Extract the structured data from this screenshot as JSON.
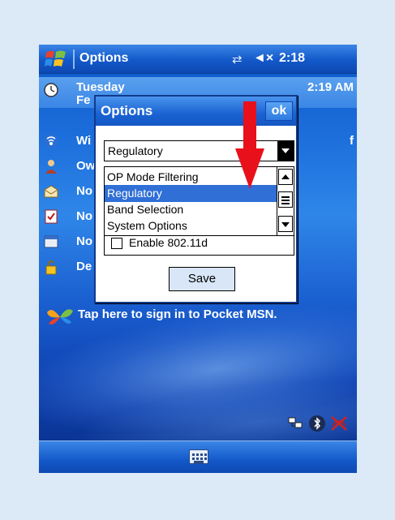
{
  "titlebar": {
    "title": "Options",
    "time": "2:18",
    "volume_glyph": "◄×",
    "connection_glyph": "⇄"
  },
  "today": {
    "day": "Tuesday",
    "date_fragment": "Fe",
    "time_right": "2:19 AM",
    "rows": [
      {
        "icon": "wireless-icon",
        "label": "Wi",
        "right": "f"
      },
      {
        "icon": "owner-icon",
        "label": "Ow",
        "right": ""
      },
      {
        "icon": "inbox-icon",
        "label": "No",
        "right": ""
      },
      {
        "icon": "tasks-icon",
        "label": "No",
        "right": ""
      },
      {
        "icon": "calendar-icon",
        "label": "No",
        "right": ""
      },
      {
        "icon": "lock-icon",
        "label": "De",
        "right": ""
      }
    ],
    "msn_text": "Tap here to sign in to Pocket MSN."
  },
  "dialog": {
    "title": "Options",
    "ok_label": "ok",
    "combo_value": "Regulatory",
    "dropdown_items": [
      "OP Mode Filtering",
      "Regulatory",
      "Band Selection",
      "System Options"
    ],
    "selected_index": 1,
    "checkbox_label": "Enable 802.11d",
    "save_label": "Save"
  },
  "tray": {
    "icons": [
      "network-tray-icon",
      "bluetooth-tray-icon",
      "wireless-off-tray-icon"
    ]
  },
  "bottombar": {
    "keyboard_icon": "keyboard-icon"
  },
  "colors": {
    "highlight": "#2f6fd6",
    "arrow": "#e8101a",
    "titlebar": "#1358c9"
  }
}
